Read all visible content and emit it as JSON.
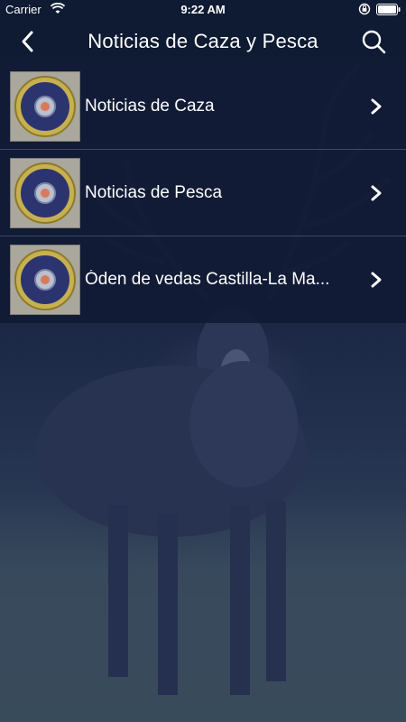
{
  "status_bar": {
    "carrier": "Carrier",
    "time": "9:22 AM",
    "icons": [
      "wifi-icon",
      "orientation-lock-icon",
      "battery-icon"
    ]
  },
  "nav": {
    "title": "Noticias de Caza y Pesca",
    "back_icon": "chevron-left-icon",
    "search_icon": "search-icon"
  },
  "list": [
    {
      "label": "Noticias de Caza",
      "icon": "shotgun-shell-icon"
    },
    {
      "label": "Noticias de Pesca",
      "icon": "shotgun-shell-icon"
    },
    {
      "label": "Óden de vedas Castilla-La Ma...",
      "icon": "shotgun-shell-icon"
    }
  ],
  "colors": {
    "bar": "#0f1a33",
    "overlay": "#1b2745"
  }
}
